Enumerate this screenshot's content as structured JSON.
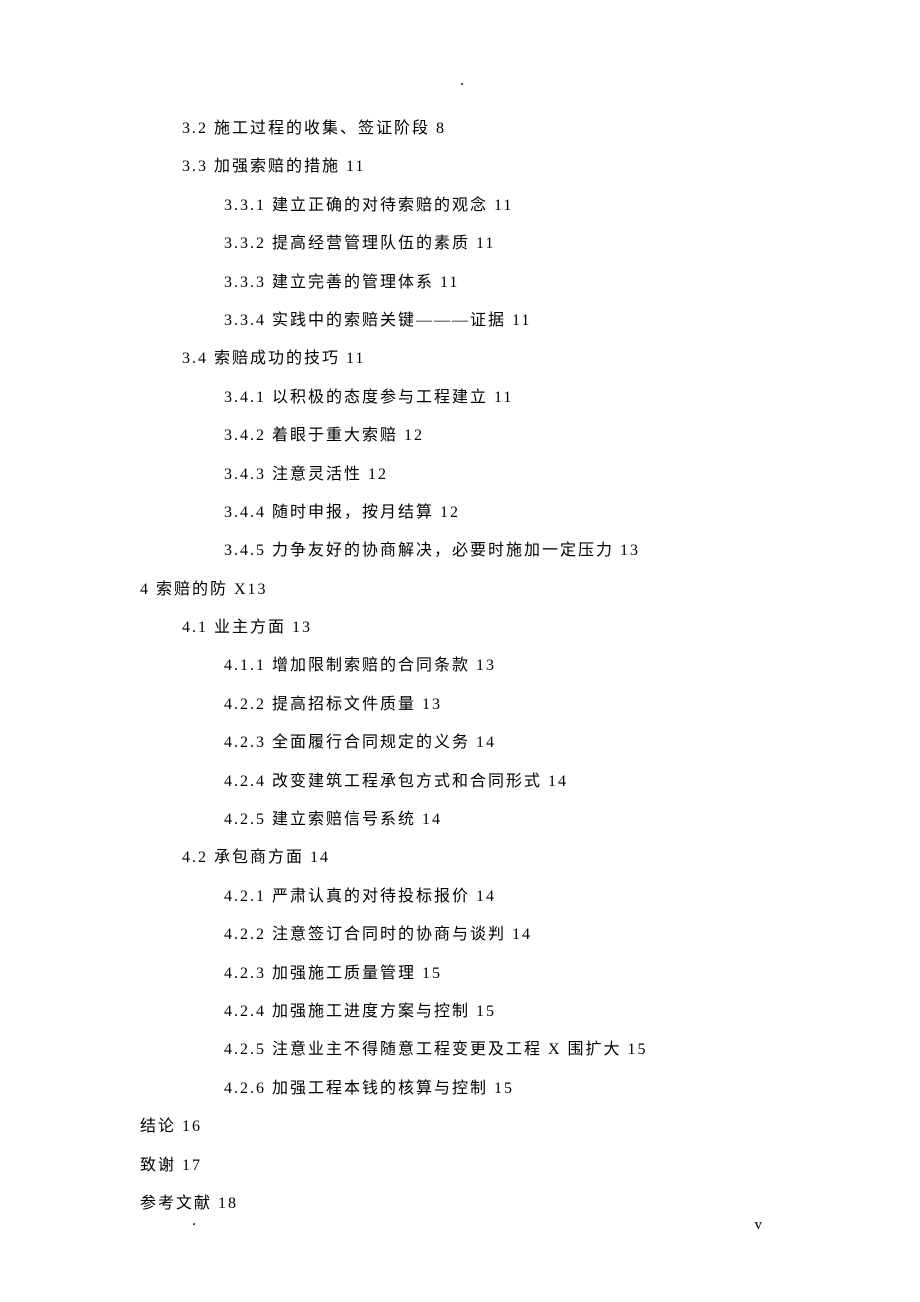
{
  "toc_lines": [
    {
      "level": 1,
      "text": "3.2 施工过程的收集、签证阶段 8"
    },
    {
      "level": 1,
      "text": "3.3 加强索赔的措施 11"
    },
    {
      "level": 2,
      "text": "3.3.1 建立正确的对待索赔的观念 11"
    },
    {
      "level": 2,
      "text": "3.3.2 提高经营管理队伍的素质 11"
    },
    {
      "level": 2,
      "text": "3.3.3 建立完善的管理体系 11"
    },
    {
      "level": 2,
      "text": "3.3.4 实践中的索赔关键———证据 11"
    },
    {
      "level": 1,
      "text": "3.4 索赔成功的技巧 11"
    },
    {
      "level": 2,
      "text": "3.4.1 以积极的态度参与工程建立 11"
    },
    {
      "level": 2,
      "text": "3.4.2 着眼于重大索赔 12"
    },
    {
      "level": 2,
      "text": "3.4.3 注意灵活性 12"
    },
    {
      "level": 2,
      "text": "3.4.4 随时申报，按月结算 12"
    },
    {
      "level": 2,
      "text": "3.4.5 力争友好的协商解决，必要时施加一定压力 13"
    },
    {
      "level": 0,
      "text": "4 索赔的防 X13"
    },
    {
      "level": 1,
      "text": "4.1 业主方面 13"
    },
    {
      "level": 2,
      "text": "4.1.1 增加限制索赔的合同条款 13"
    },
    {
      "level": 2,
      "text": "4.2.2 提高招标文件质量 13"
    },
    {
      "level": 2,
      "text": "4.2.3 全面履行合同规定的义务 14"
    },
    {
      "level": 2,
      "text": "4.2.4 改变建筑工程承包方式和合同形式 14"
    },
    {
      "level": 2,
      "text": "4.2.5 建立索赔信号系统 14"
    },
    {
      "level": 1,
      "text": "4.2 承包商方面 14"
    },
    {
      "level": 2,
      "text": "4.2.1 严肃认真的对待投标报价 14"
    },
    {
      "level": 2,
      "text": "4.2.2 注意签订合同时的协商与谈判 14"
    },
    {
      "level": 2,
      "text": "4.2.3 加强施工质量管理 15"
    },
    {
      "level": 2,
      "text": "4.2.4 加强施工进度方案与控制 15"
    },
    {
      "level": 2,
      "text": "4.2.5 注意业主不得随意工程变更及工程 X 围扩大 15"
    },
    {
      "level": 2,
      "text": "4.2.6 加强工程本钱的核算与控制 15"
    },
    {
      "level": 0,
      "text": "结论 16"
    },
    {
      "level": 0,
      "text": "致谢 17"
    },
    {
      "level": 0,
      "text": "参考文献 18"
    }
  ],
  "marks": {
    "dot_top": ".",
    "dot_bottom": ".",
    "page_number": "v"
  }
}
